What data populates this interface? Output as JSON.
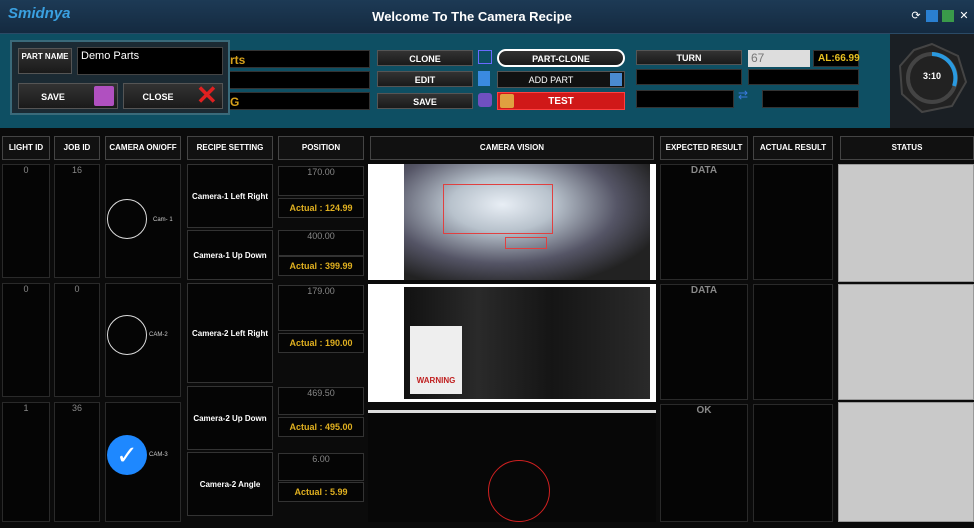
{
  "app": {
    "brand": "Smidnya",
    "title": "Welcome To The Camera Recipe"
  },
  "window_buttons": {
    "refresh": "⟳",
    "minimize": "▭",
    "calculator": "▦",
    "close": "✕"
  },
  "part_panel": {
    "part_name_label": "PART NAME",
    "part_name_value": "Demo Parts",
    "save_label": "SAVE",
    "close_label": "CLOSE"
  },
  "toolbar": {
    "field1": "rts",
    "field2": "",
    "field3": "G",
    "clone": "CLONE",
    "edit": "EDIT",
    "save": "SAVE",
    "part_clone": "PART-CLONE",
    "add_part": "ADD PART",
    "test": "TEST",
    "turn": "TURN",
    "turn_value": "67",
    "al_value": "AL:66.99"
  },
  "clock": {
    "time": "3:10"
  },
  "columns": {
    "light_id": "LIGHT ID",
    "job_id": "JOB ID",
    "camera": "CAMERA ON/OFF",
    "recipe": "RECIPE SETTING",
    "position": "POSITION",
    "vision": "CAMERA VISION",
    "expected": "EXPECTED RESULT",
    "actual": "ACTUAL RESULT",
    "status": "STATUS"
  },
  "rows": [
    {
      "light_id": "0",
      "job_id": "16",
      "cam_label": "Cam- 1",
      "checked": false,
      "expected": "DATA"
    },
    {
      "light_id": "0",
      "job_id": "0",
      "cam_label": "CAM-2",
      "checked": false,
      "expected": "DATA"
    },
    {
      "light_id": "1",
      "job_id": "36",
      "cam_label": "CAM-3",
      "checked": true,
      "expected": "OK"
    }
  ],
  "recipes": [
    {
      "name": "Camera-1 Left Right",
      "position": "170.00",
      "actual": "Actual : 124.99"
    },
    {
      "name": "Camera-1 Up Down",
      "position": "400.00",
      "actual": "Actual : 399.99"
    },
    {
      "name": "Camera-2 Left Right",
      "position": "179.00",
      "actual": "Actual : 190.00"
    },
    {
      "name": "Camera-2 Up Down",
      "position": "469.50",
      "actual": "Actual : 495.00"
    },
    {
      "name": "Camera-2 Angle",
      "position": "6.00",
      "actual": "Actual : 5.99"
    }
  ],
  "vision": {
    "sign_text": "WARNING"
  }
}
